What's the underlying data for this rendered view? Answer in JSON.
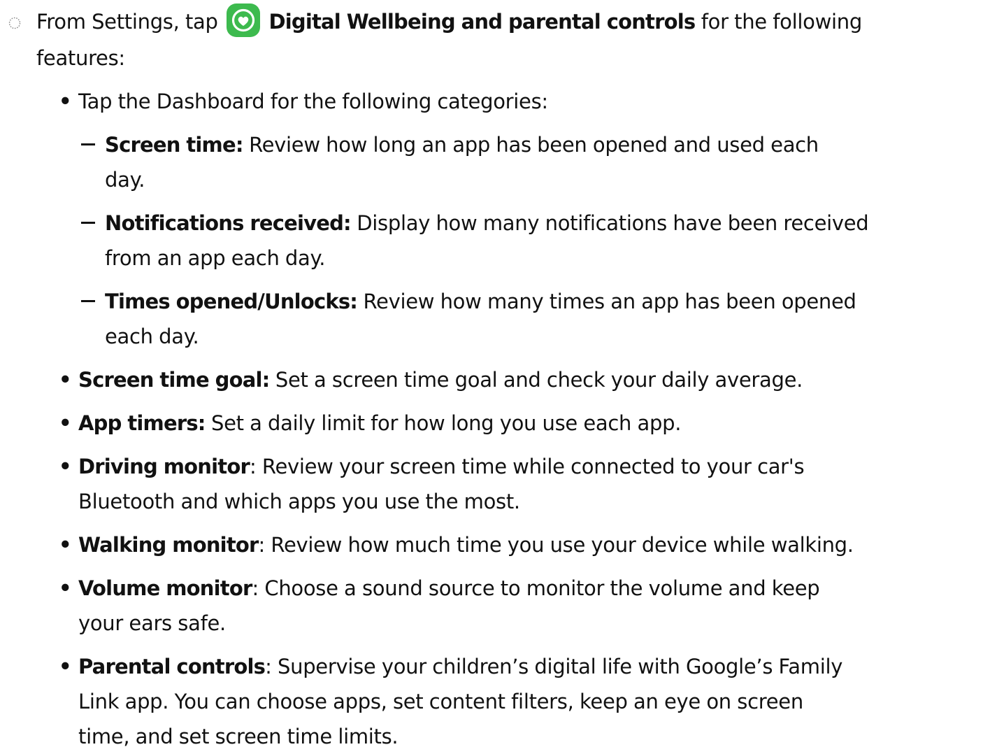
{
  "intro": {
    "prefix": "From Settings, tap",
    "app_name": "Digital Wellbeing and parental controls",
    "suffix": "for the following",
    "continuation": "features:"
  },
  "dashboard": {
    "text": "Tap the Dashboard for the following categories:",
    "items": [
      {
        "term": "Screen time:",
        "desc1": "Review how long an app has been opened and used each",
        "desc2": "day."
      },
      {
        "term": "Notifications received:",
        "desc1": "Display how many notifications have been received",
        "desc2": "from an app each day."
      },
      {
        "term": "Times opened/Unlocks:",
        "desc1": "Review how many times an app has been opened",
        "desc2": "each day."
      }
    ]
  },
  "features": [
    {
      "term": "Screen time goal:",
      "lines": [
        "Set a screen time goal and check your daily average."
      ]
    },
    {
      "term": "App timers:",
      "lines": [
        "Set a daily limit for how long you use each app."
      ]
    },
    {
      "term": "Driving monitor",
      "colon": ":",
      "lines": [
        "Review your screen time while connected to your car's",
        "Bluetooth and which apps you use the most."
      ]
    },
    {
      "term": "Walking monitor",
      "colon": ":",
      "lines": [
        "Review how much time you use your device while walking."
      ]
    },
    {
      "term": "Volume monitor",
      "colon": ":",
      "lines": [
        "Choose a sound source to monitor the volume and keep",
        "your ears safe."
      ]
    },
    {
      "term": "Parental controls",
      "colon": ":",
      "lines": [
        "Supervise your children’s digital life with Google’s Family",
        "Link app. You can choose apps, set content filters, keep an eye on screen",
        "time, and set screen time limits."
      ]
    }
  ],
  "icons": {
    "step_marker": "dotted-circle-icon",
    "app_icon": "digital-wellbeing-icon",
    "app_icon_color": "#3dba4e"
  }
}
